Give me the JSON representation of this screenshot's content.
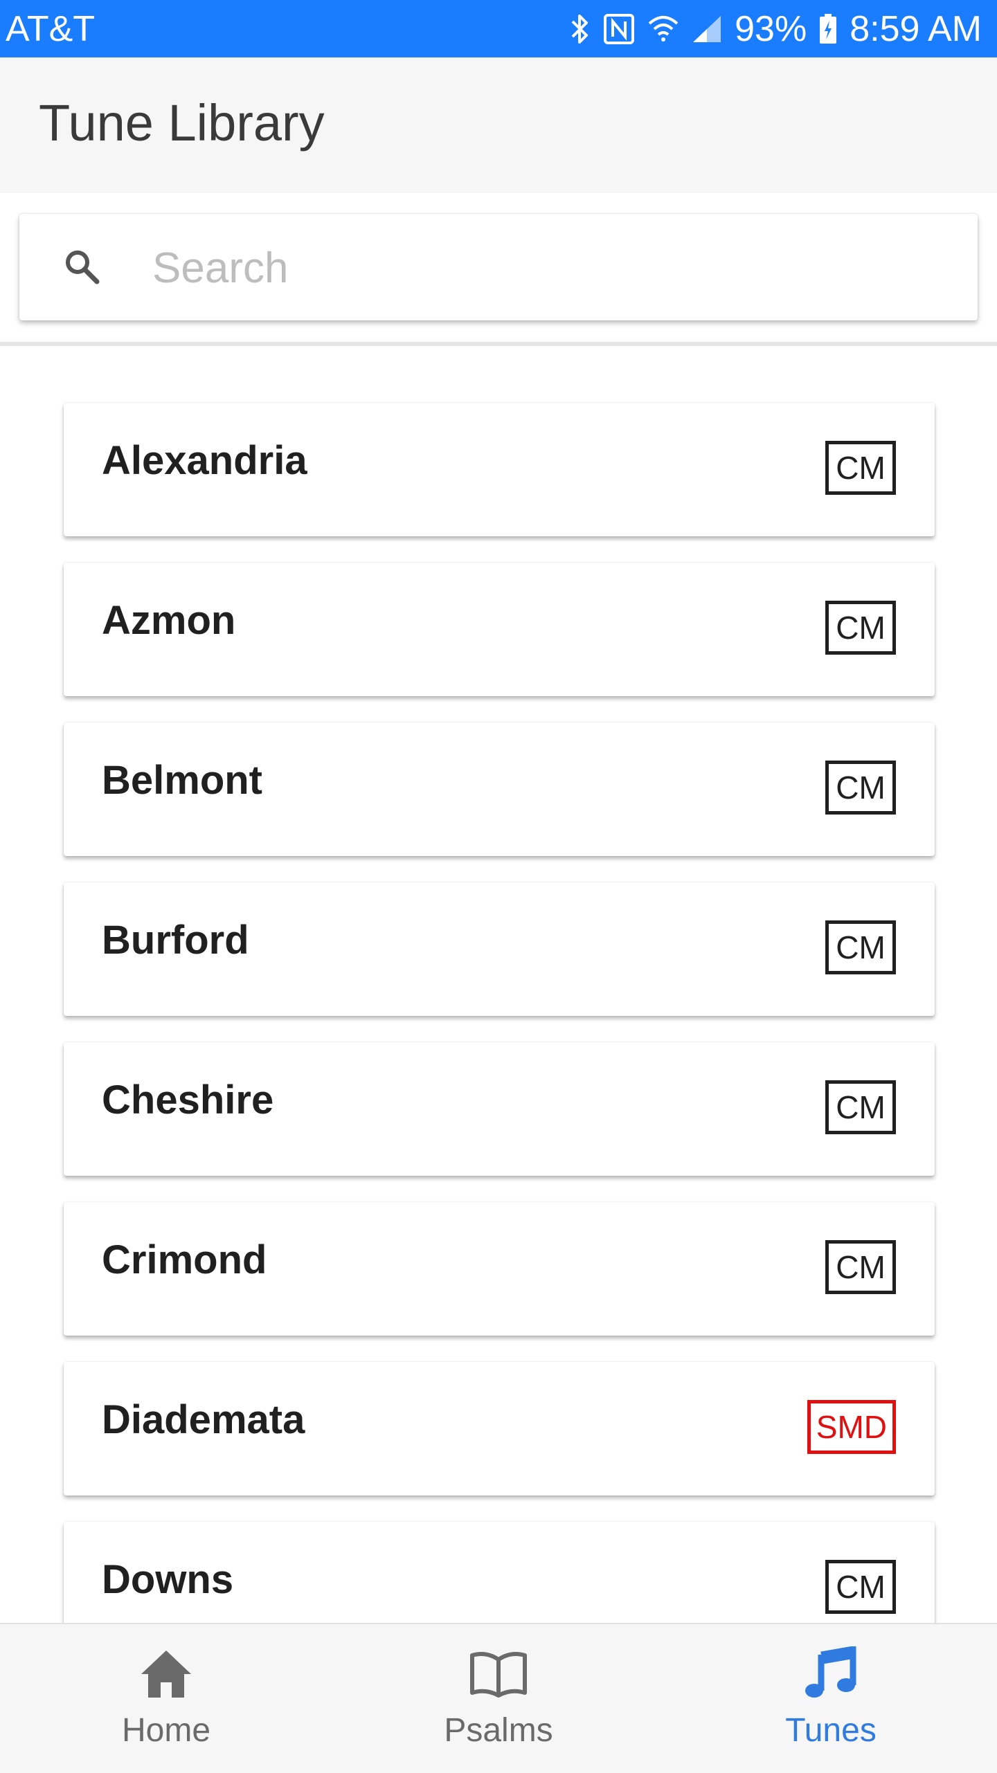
{
  "status_bar": {
    "carrier": "AT&T",
    "battery": "93%",
    "time": "8:59 AM",
    "icons": [
      "bluetooth-icon",
      "nfc-icon",
      "wifi-icon",
      "signal-icon",
      "battery-charging-icon"
    ]
  },
  "header": {
    "title": "Tune Library"
  },
  "search": {
    "placeholder": "Search",
    "value": "",
    "icon": "search-icon"
  },
  "colors": {
    "status_bar": "#1a7cff",
    "accent": "#2f7be0",
    "badge_red": "#e01010",
    "badge_default": "#202020"
  },
  "tunes": [
    {
      "name": "Alexandria",
      "meter": "CM"
    },
    {
      "name": "Azmon",
      "meter": "CM"
    },
    {
      "name": "Belmont",
      "meter": "CM"
    },
    {
      "name": "Burford",
      "meter": "CM"
    },
    {
      "name": "Cheshire",
      "meter": "CM"
    },
    {
      "name": "Crimond",
      "meter": "CM"
    },
    {
      "name": "Diademata",
      "meter": "SMD"
    },
    {
      "name": "Downs",
      "meter": "CM"
    }
  ],
  "bottom_nav": {
    "items": [
      {
        "label": "Home",
        "icon": "home-icon"
      },
      {
        "label": "Psalms",
        "icon": "book-icon"
      },
      {
        "label": "Tunes",
        "icon": "music-note-icon"
      }
    ],
    "active": "Tunes"
  }
}
